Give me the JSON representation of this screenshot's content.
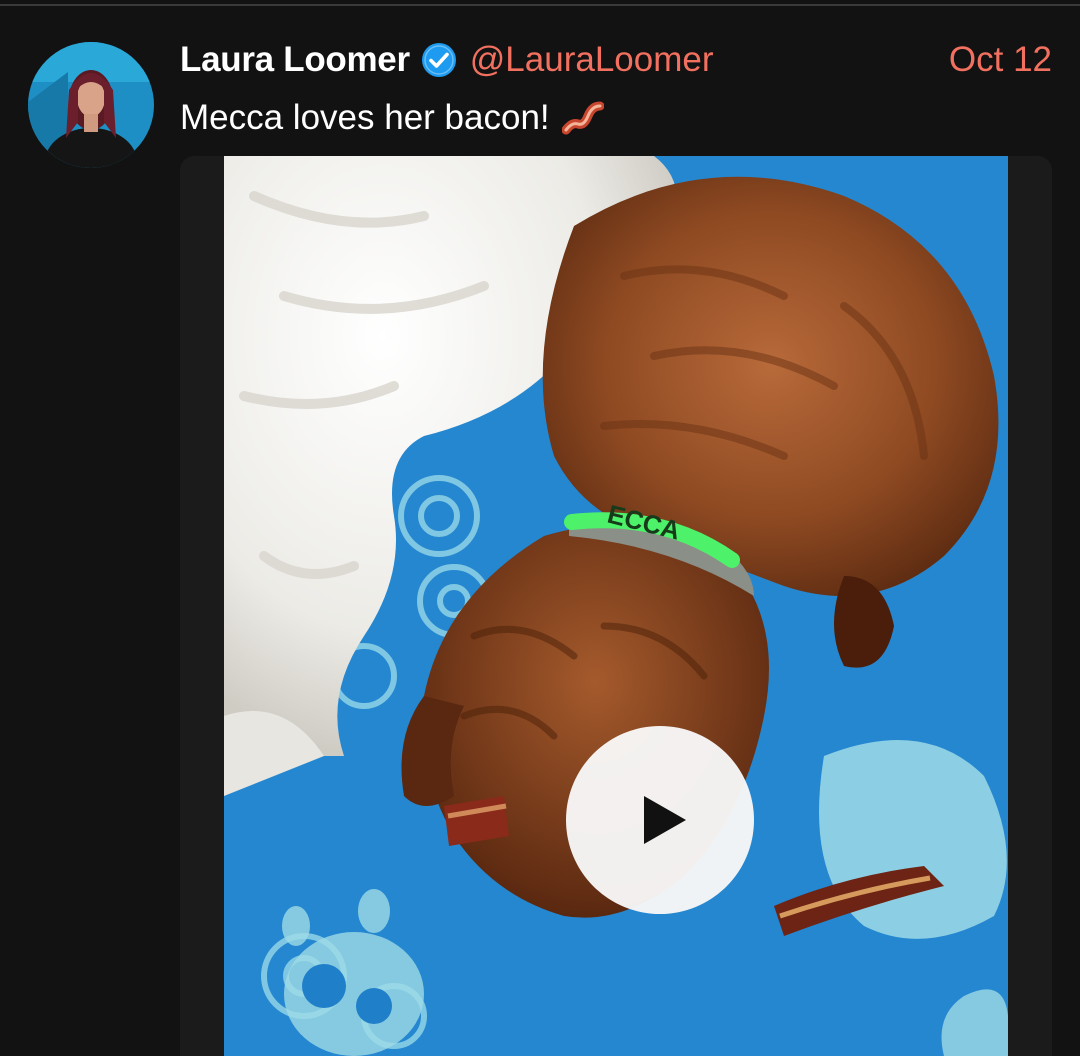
{
  "post": {
    "author_name": "Laura Loomer",
    "handle": "@LauraLoomer",
    "date": "Oct 12",
    "text": "Mecca loves her bacon!",
    "emoji": "bacon-emoji"
  },
  "media": {
    "type": "video",
    "collar_text": "ECCA"
  },
  "icons": {
    "verified": "verified-badge-icon",
    "play": "play-icon"
  },
  "colors": {
    "background": "#121212",
    "accent": "#f2705f",
    "verified": "#1d9bf0",
    "text": "#ffffff"
  }
}
